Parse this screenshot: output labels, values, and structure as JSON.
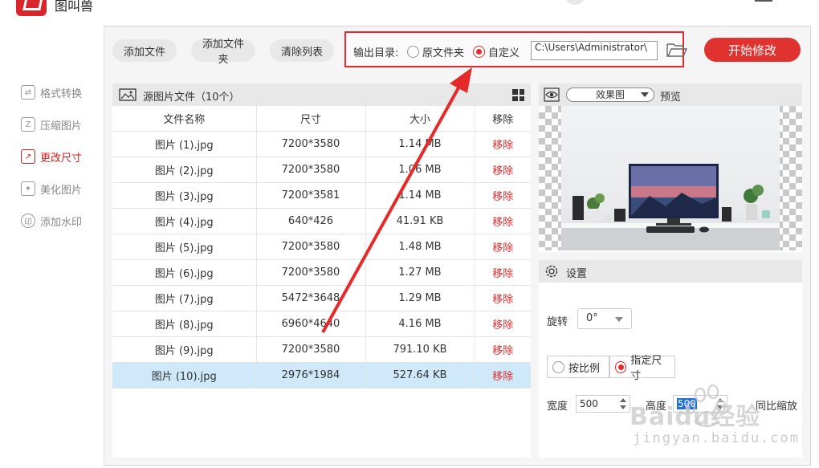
{
  "app": {
    "title": "图叫兽"
  },
  "sidebar": {
    "items": [
      {
        "label": "格式转换",
        "icon": "format-convert-icon",
        "active": false
      },
      {
        "label": "压缩图片",
        "icon": "compress-icon",
        "active": false
      },
      {
        "label": "更改尺寸",
        "icon": "resize-icon",
        "active": true
      },
      {
        "label": "美化图片",
        "icon": "beautify-icon",
        "active": false
      },
      {
        "label": "添加水印",
        "icon": "watermark-icon",
        "active": false
      }
    ]
  },
  "toolbar": {
    "add_file": "添加文件",
    "add_folder": "添加文件夹",
    "clear_list": "清除列表",
    "output_label": "输出目录:",
    "opt_source": "原文件夹",
    "opt_custom": "自定义",
    "selected_option": "自定义",
    "output_path": "C:\\Users\\Administrator\\",
    "start": "开始修改"
  },
  "file_list": {
    "title": "源图片文件（10个）",
    "columns": [
      "文件名称",
      "尺寸",
      "大小",
      "移除"
    ],
    "rows": [
      {
        "name": "图片 (1).jpg",
        "size": "7200*3580",
        "filesize": "1.14 MB",
        "remove": "移除"
      },
      {
        "name": "图片 (2).jpg",
        "size": "7200*3580",
        "filesize": "1.06 MB",
        "remove": "移除"
      },
      {
        "name": "图片 (3).jpg",
        "size": "7200*3581",
        "filesize": "1.14 MB",
        "remove": "移除"
      },
      {
        "name": "图片 (4).jpg",
        "size": "640*426",
        "filesize": "41.91 KB",
        "remove": "移除"
      },
      {
        "name": "图片 (5).jpg",
        "size": "7200*3580",
        "filesize": "1.48 MB",
        "remove": "移除"
      },
      {
        "name": "图片 (6).jpg",
        "size": "7200*3580",
        "filesize": "1.27 MB",
        "remove": "移除"
      },
      {
        "name": "图片 (7).jpg",
        "size": "5472*3648",
        "filesize": "1.29 MB",
        "remove": "移除"
      },
      {
        "name": "图片 (8).jpg",
        "size": "6960*4640",
        "filesize": "4.16 MB",
        "remove": "移除"
      },
      {
        "name": "图片 (9).jpg",
        "size": "7200*3580",
        "filesize": "791.10 KB",
        "remove": "移除"
      },
      {
        "name": "图片 (10).jpg",
        "size": "2976*1984",
        "filesize": "527.64 KB",
        "remove": "移除"
      }
    ],
    "selected_index": 9
  },
  "preview": {
    "mode": "效果图",
    "label": "预览"
  },
  "settings": {
    "title": "设置",
    "rotate_label": "旋转",
    "rotate_value": "0°",
    "mode_ratio": "按比例",
    "mode_fixed": "指定尺寸",
    "selected_mode": "指定尺寸",
    "width_label": "宽度",
    "width_value": "500",
    "height_label": "高度",
    "height_value": "500",
    "keep_ratio_label": "同比缩放"
  },
  "watermark": {
    "brand": "Baidu经验",
    "url": "jingyan.baidu.com"
  },
  "colors": {
    "accent": "#e0322f",
    "active_nav": "#c8201f",
    "annotation": "#e52a2a",
    "selected_row": "#cfe9fa"
  }
}
